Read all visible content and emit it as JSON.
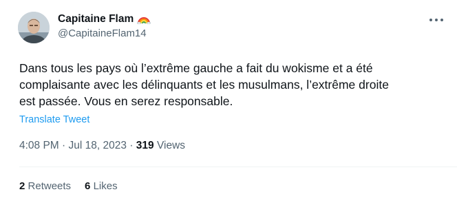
{
  "author": {
    "display_name": "Capitaine Flam",
    "handle": "@CapitaineFlam14",
    "badge_icon": "rainbow-icon"
  },
  "tweet": {
    "lines": [
      "Dans tous les pays où l’extrême gauche a fait du wokisme et a été",
      "complaisante avec les délinquants et les musulmans, l’extrême droite",
      "est passée. Vous en serez responsable."
    ],
    "translate_label": "Translate Tweet"
  },
  "meta": {
    "time": "4:08 PM",
    "separator": "·",
    "date": "Jul 18, 2023",
    "views_count": "319",
    "views_label": "Views"
  },
  "stats": {
    "retweets_count": "2",
    "retweets_label": "Retweets",
    "likes_count": "6",
    "likes_label": "Likes"
  },
  "colors": {
    "link": "#1d9bf0",
    "secondary_text": "#536471",
    "primary_text": "#0f1419"
  }
}
